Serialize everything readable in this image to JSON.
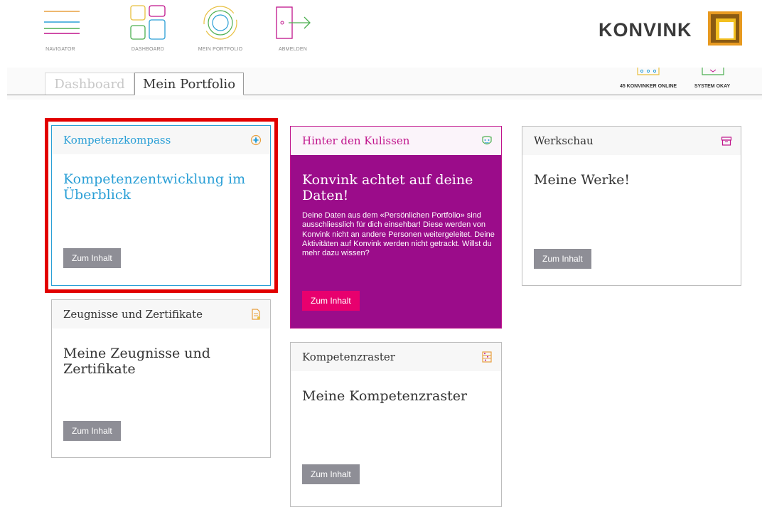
{
  "topnav": {
    "items": [
      {
        "label": "NAVIGATOR",
        "icon": "menu-lines-icon"
      },
      {
        "label": "DASHBOARD",
        "icon": "dashboard-tiles-icon"
      },
      {
        "label": "MEIN PORTFOLIO",
        "icon": "portfolio-circles-icon"
      },
      {
        "label": "ABMELDEN",
        "icon": "logout-door-icon"
      }
    ],
    "brand": "KONVINK"
  },
  "tabs": {
    "dashboard": "Dashboard",
    "portfolio": "Mein Portfolio"
  },
  "status": {
    "online": "45 KONVINKER ONLINE",
    "system": "SYSTEM OKAY"
  },
  "cards": {
    "kompass": {
      "title": "Kompetenzkompass",
      "heading": "Kompetenzentwicklung im Überblick",
      "button": "Zum Inhalt",
      "icon": "compass-icon"
    },
    "zeugnisse": {
      "title": "Zeugnisse und Zertifikate",
      "heading": "Meine Zeugnisse und Zertifikate",
      "button": "Zum Inhalt",
      "icon": "document-icon"
    },
    "kulissen": {
      "title": "Hinter den Kulissen",
      "heading": "Konvink achtet auf deine Daten!",
      "text": "Deine Daten aus dem «Persönlichen Portfolio» sind ausschliesslich für dich einsehbar! Diese werden von Konvink nicht an andere Personen weitergeleitet. Deine Aktivitäten auf Konvink werden nicht getrackt. Willst du mehr dazu wissen?",
      "button": "Zum Inhalt",
      "icon": "theater-mask-icon"
    },
    "raster": {
      "title": "Kompetenzraster",
      "heading": "Meine Kompetenzraster",
      "button": "Zum Inhalt",
      "icon": "grid-list-icon"
    },
    "werkschau": {
      "title": "Werkschau",
      "heading": "Meine Werke!",
      "button": "Zum Inhalt",
      "icon": "archive-box-icon"
    }
  },
  "colors": {
    "highlight": "#e20000",
    "accent_blue": "#2a9fd6",
    "purple": "#9b0c8a",
    "pink": "#e8006e",
    "button_gray": "#8e8e96"
  }
}
